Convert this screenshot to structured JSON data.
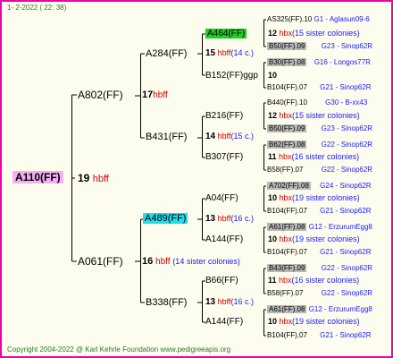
{
  "header": {
    "date_line": "1-  2-2022 ( 22: 38)"
  },
  "footer": {
    "copyright": "Copyright 2004-2022 @ Karl Kehrle Foundation   www.pedigreeapis.org"
  },
  "root": {
    "code": "A110(FF)",
    "count": "19",
    "hbff": "hbff"
  },
  "parents": [
    {
      "code": "A802(FF)",
      "count": "17",
      "hbff": "hbff"
    },
    {
      "code": "A061(FF)",
      "count": "16",
      "hbff": "hbff",
      "note": "(14 sister colonies)"
    }
  ],
  "grandparents": [
    {
      "code": "A284(FF)",
      "count": "15",
      "hbff": "hbff",
      "note": "(14 c.)"
    },
    {
      "code": "B431(FF)",
      "count": "14",
      "hbff": "hbff",
      "note": "(15 c.)"
    },
    {
      "code": "A489(FF)",
      "count": "13",
      "hbff": "hbff",
      "note": "(16 c.)"
    },
    {
      "code": "B338(FF)",
      "count": "13",
      "hbff": "hbff",
      "note": "(16 c.)"
    }
  ],
  "great_grandparents": [
    {
      "code": "A464(FF)",
      "count": "12",
      "hbx": "hbx",
      "note": "(15 sister colonies)"
    },
    {
      "code": "B152(FF)ggp",
      "count": "10",
      "hbx": "",
      "note": ""
    },
    {
      "code": "B216(FF)",
      "count": "12",
      "hbx": "hbx",
      "note": "(15 sister colonies)"
    },
    {
      "code": "B307(FF)",
      "count": "11",
      "hbx": "hbx",
      "note": "(16 sister colonies)"
    },
    {
      "code": "A04(FF)",
      "count": "10",
      "hbx": "hbx",
      "note": "(19 sister colonies)"
    },
    {
      "code": "A144(FF)",
      "count": "10",
      "hbx": "hbx",
      "note": "(19 sister colonies)"
    },
    {
      "code": "B66(FF)",
      "count": "11",
      "hbx": "hbx",
      "note": "(16 sister colonies)"
    },
    {
      "code": "A144(FF)",
      "count": "10",
      "hbx": "hbx",
      "note": "(19 sister colonies)"
    }
  ],
  "ancestors": [
    {
      "top": "AS325(FF).10",
      "top_loc": "G1 - Aglasun09-6",
      "bottom": "B50(FF).09",
      "bottom_loc": "G23 - Sinop62R"
    },
    {
      "top": "B30(FF).08",
      "top_loc": "G16 - Longos77R",
      "bottom": "B104(FF).07",
      "bottom_loc": "G21 - Sinop62R"
    },
    {
      "top": "B440(FF).10",
      "top_loc": "G30 - B-xx43",
      "bottom": "B50(FF).09",
      "bottom_loc": "G23 - Sinop62R"
    },
    {
      "top": "B62(FF).08",
      "top_loc": "G22 - Sinop62R",
      "bottom": "B58(FF).07",
      "bottom_loc": "G22 - Sinop62R"
    },
    {
      "top": "A702(FF).08",
      "top_loc": "G24 - Sinop62R",
      "bottom": "B104(FF).07",
      "bottom_loc": "G21 - Sinop62R"
    },
    {
      "top": "A61(FF).08",
      "top_loc": "G12 - ErzurumEgg8",
      "bottom": "B104(FF).07",
      "bottom_loc": "G21 - Sinop62R"
    },
    {
      "top": "B43(FF).09",
      "top_loc": "G22 - Sinop62R",
      "bottom": "B58(FF).07",
      "bottom_loc": "G22 - Sinop62R"
    },
    {
      "top": "A61(FF).08",
      "top_loc": "G12 - ErzurumEgg8",
      "bottom": "B104(FF).07",
      "bottom_loc": "G21 - Sinop62R"
    }
  ]
}
